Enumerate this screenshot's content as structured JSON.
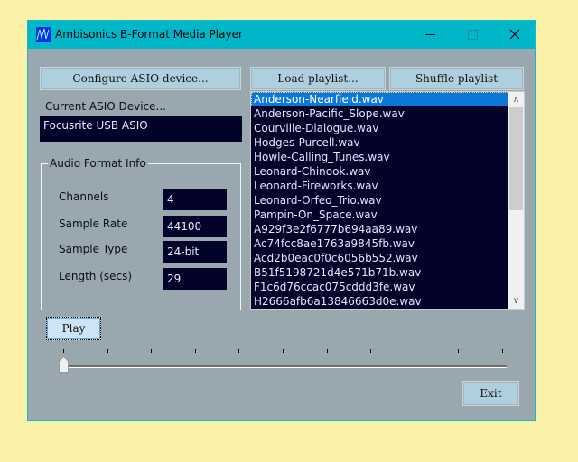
{
  "window": {
    "title": "Ambisonics B-Format Media Player",
    "controls": [
      "minimize",
      "maximize",
      "close"
    ]
  },
  "asio": {
    "configure_label": "Configure ASIO device...",
    "current_label": "Current ASIO Device...",
    "current_value": "Focusrite USB ASIO"
  },
  "format_info": {
    "title": "Audio Format Info",
    "channels_label": "Channels",
    "channels_value": "4",
    "sample_rate_label": "Sample Rate",
    "sample_rate_value": "44100",
    "sample_type_label": "Sample Type",
    "sample_type_value": "24-bit",
    "length_label": "Length (secs)",
    "length_value": "29"
  },
  "playlist": {
    "load_label": "Load playlist...",
    "shuffle_label": "Shuffle playlist",
    "selected_index": 0,
    "items": [
      "Anderson-Nearfield.wav",
      "Anderson-Pacific_Slope.wav",
      "Courville-Dialogue.wav",
      "Hodges-Purcell.wav",
      "Howle-Calling_Tunes.wav",
      "Leonard-Chinook.wav",
      "Leonard-Fireworks.wav",
      "Leonard-Orfeo_Trio.wav",
      "Pampin-On_Space.wav",
      "A929f3e2f6777b694aa89.wav",
      "Ac74fcc8ae1763a9845fb.wav",
      "Acd2b0eac0f0c6056b552.wav",
      "B51f5198721d4e571b71b.wav",
      "F1c6d76ccac075cddd3fe.wav",
      "H2666afb6a13846663d0e.wav"
    ]
  },
  "transport": {
    "play_label": "Play",
    "exit_label": "Exit",
    "position_fraction": 0.0,
    "tick_count": 11
  }
}
